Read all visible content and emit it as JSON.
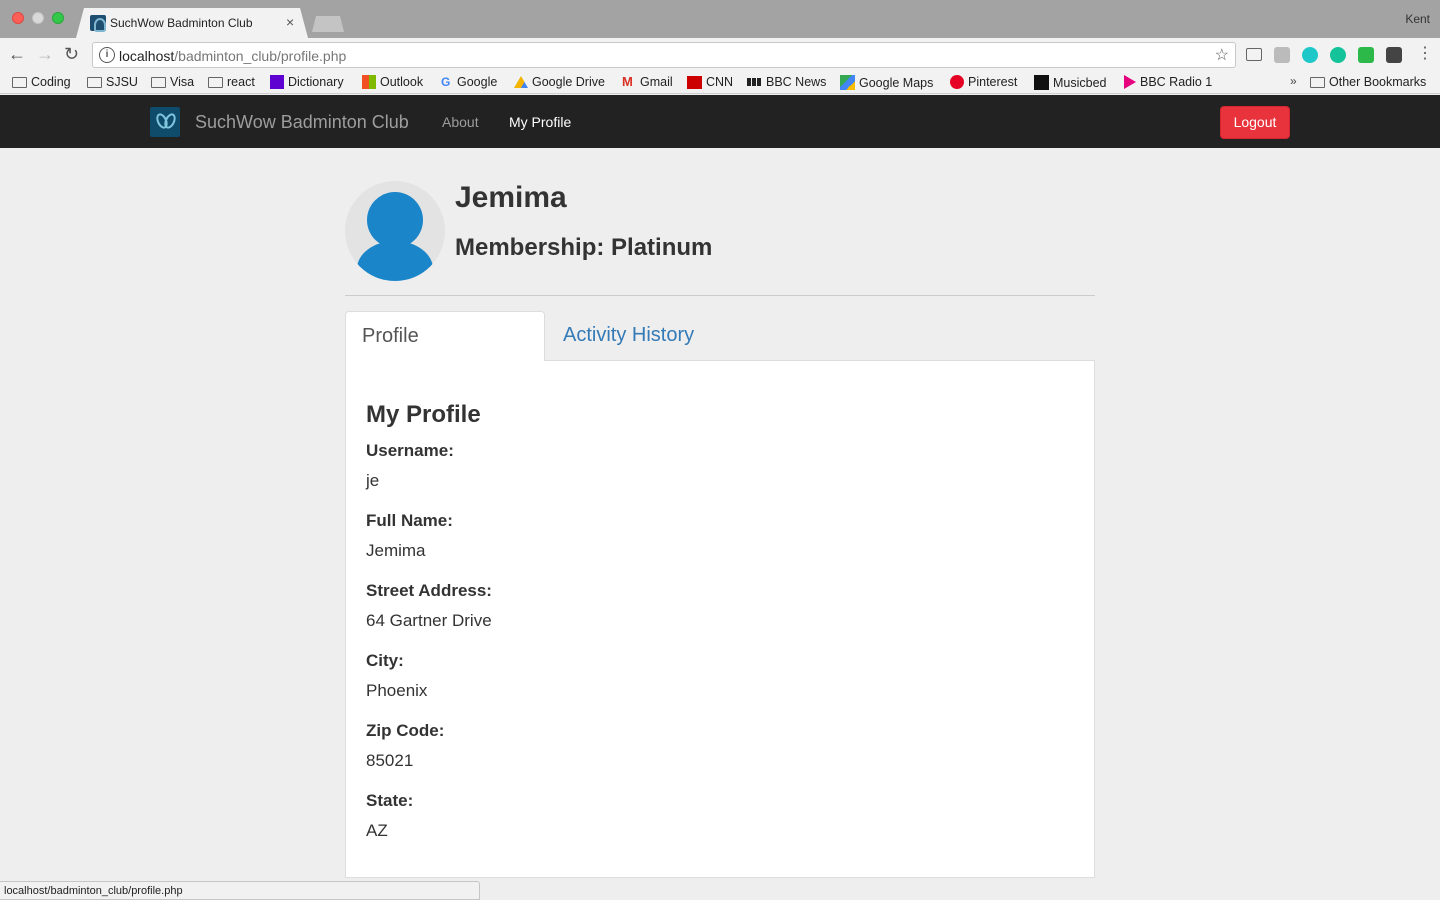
{
  "browser": {
    "tab_title": "SuchWow Badminton Club",
    "tab_close": "×",
    "user": "Kent",
    "url_host": "localhost",
    "url_path": "/badminton_club/profile.php",
    "bookmarks": [
      {
        "label": "Coding",
        "icon": "folder-icon"
      },
      {
        "label": "SJSU",
        "icon": "folder-icon"
      },
      {
        "label": "Visa",
        "icon": "folder-icon"
      },
      {
        "label": "react",
        "icon": "folder-icon"
      },
      {
        "label": "Dictionary",
        "icon": "yahoo-icon"
      },
      {
        "label": "Outlook",
        "icon": "outlook-icon"
      },
      {
        "label": "Google",
        "icon": "google-icon"
      },
      {
        "label": "Google Drive",
        "icon": "google-drive-icon"
      },
      {
        "label": "Gmail",
        "icon": "gmail-icon"
      },
      {
        "label": "CNN",
        "icon": "cnn-icon"
      },
      {
        "label": "BBC News",
        "icon": "bbc-icon"
      },
      {
        "label": "Google Maps",
        "icon": "google-maps-icon"
      },
      {
        "label": "Pinterest",
        "icon": "pinterest-icon"
      },
      {
        "label": "Musicbed",
        "icon": "musicbed-icon"
      },
      {
        "label": "BBC Radio 1",
        "icon": "bbc-radio-icon"
      }
    ],
    "bookmarks_more": "»",
    "other_bookmarks": "Other Bookmarks",
    "status_url": "localhost/badminton_club/profile.php"
  },
  "navbar": {
    "brand": "SuchWow Badminton Club",
    "links": [
      "About",
      "My Profile"
    ],
    "logout": "Logout"
  },
  "profile_header": {
    "name": "Jemima",
    "membership": "Membership: Platinum"
  },
  "tabs": [
    "Profile",
    "Activity History"
  ],
  "panel": {
    "title": "My Profile",
    "fields": [
      {
        "label": "Username:",
        "value": "je"
      },
      {
        "label": "Full Name:",
        "value": "Jemima"
      },
      {
        "label": "Street Address:",
        "value": "64 Gartner Drive"
      },
      {
        "label": "City:",
        "value": "Phoenix"
      },
      {
        "label": "Zip Code:",
        "value": "85021"
      },
      {
        "label": "State:",
        "value": "AZ"
      }
    ]
  },
  "colors": {
    "navbar_bg": "#222222",
    "logout_btn": "#e8333c",
    "link_blue": "#337ab7",
    "avatar_blue": "#1a85c9",
    "page_bg": "#eeeeee"
  }
}
